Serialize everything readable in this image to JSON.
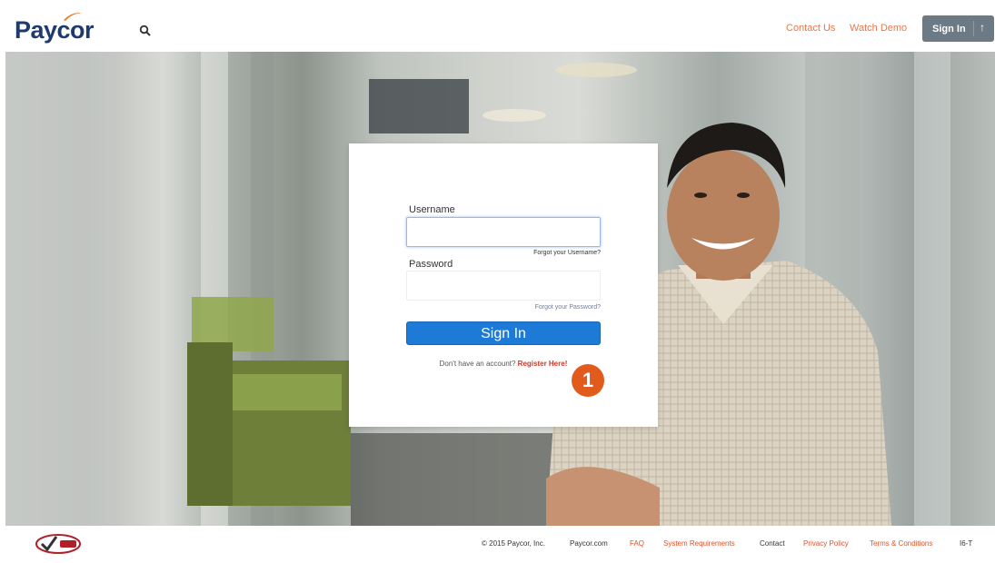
{
  "header": {
    "logo_text": "Paycor",
    "links": {
      "contact": "Contact Us",
      "demo": "Watch Demo"
    },
    "signin_label": "Sign In",
    "signin_arrow": "↑"
  },
  "login": {
    "username_label": "Username",
    "username_value": "",
    "forgot_username": "Forgot your Username?",
    "password_label": "Password",
    "password_value": "",
    "forgot_password": "Forgot your Password?",
    "signin_button": "Sign In",
    "register_prefix": "Don't have an account?",
    "register_link": "Register Here!",
    "callout_number": "1"
  },
  "footer": {
    "copyright": "© 2015 Paycor, Inc.",
    "links": {
      "paycor": "Paycor.com",
      "faq": "FAQ",
      "system": "System Requirements",
      "contact": "Contact",
      "privacy": "Privacy Policy",
      "terms": "Terms & Conditions"
    },
    "code": "I6-T"
  },
  "colors": {
    "brand_navy": "#1f3a6e",
    "brand_orange": "#e8774a",
    "signin_blue": "#1d7ad6",
    "header_button_gray": "#6c7a86",
    "callout_orange": "#e35a1d"
  },
  "icons": {
    "search": "search-icon",
    "arrow": "arrow-up-icon",
    "badge": "verified-badge-icon"
  }
}
